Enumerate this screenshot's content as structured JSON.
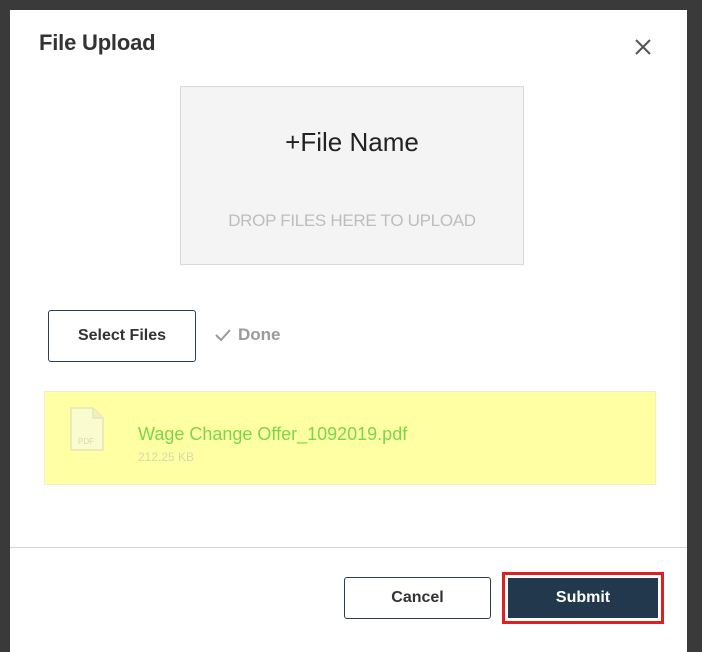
{
  "dialog": {
    "title": "File Upload",
    "close_icon": "close-icon"
  },
  "dropzone": {
    "title": "+File Name",
    "hint": "DROP FILES HERE TO UPLOAD"
  },
  "actions": {
    "select_files_label": "Select Files",
    "done_label": "Done",
    "done_icon": "check-icon"
  },
  "files": [
    {
      "name": "Wage Change Offer_1092019.pdf",
      "size": "212.25 KB",
      "icon_label": "PDF",
      "icon": "pdf-file-icon"
    }
  ],
  "footer": {
    "cancel_label": "Cancel",
    "submit_label": "Submit"
  },
  "colors": {
    "file_row_bg": "#ffffa3",
    "file_name": "#7bd64a",
    "submit_bg": "#22394d",
    "highlight": "#e02020"
  }
}
